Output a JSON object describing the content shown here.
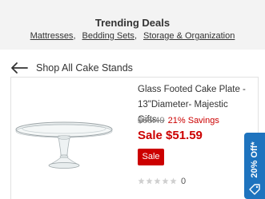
{
  "trending": {
    "title": "Trending Deals",
    "links": [
      "Mattresses",
      "Bedding Sets",
      "Storage & Organization"
    ],
    "separator": ","
  },
  "back": {
    "label": "Shop All Cake Stands",
    "icon": "arrow-left-icon"
  },
  "product": {
    "title": "Glass Footed Cake Plate - 13\"Diameter- Majestic Gifts...",
    "original_price": "$65.49",
    "savings": "21% Savings",
    "sale_price": "Sale $51.59",
    "badge": "Sale",
    "rating": 0,
    "rating_max": 5,
    "review_count": "0"
  },
  "promo_tab": {
    "label": "20% Off*",
    "icon": "tag-icon"
  },
  "colors": {
    "sale_red": "#cc0000",
    "promo_blue": "#1e73be",
    "band_gray": "#f3f3f3",
    "star_gray": "#cfcfcf"
  }
}
